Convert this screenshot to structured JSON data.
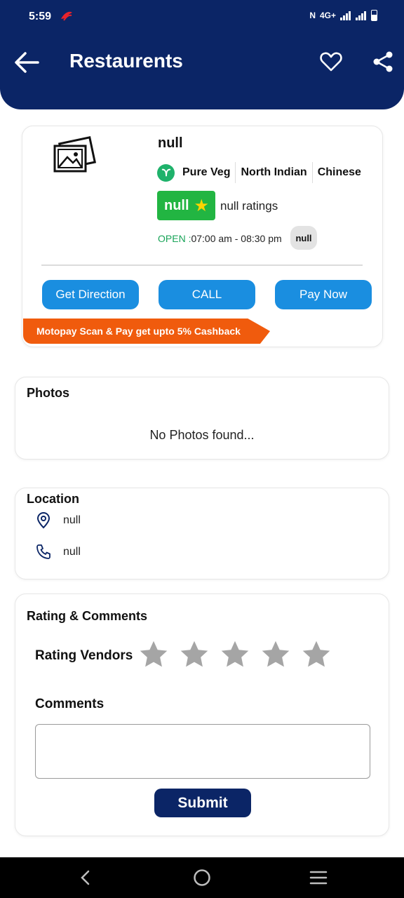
{
  "status_bar": {
    "time": "5:59",
    "network": "4G+"
  },
  "header": {
    "title": "Restaurents"
  },
  "restaurant": {
    "name": "null",
    "tags": [
      "Pure Veg",
      "North Indian",
      "Chinese"
    ],
    "rating_value": "null",
    "rating_text": "null ratings",
    "open_label": "OPEN :",
    "hours": "07:00 am - 08:30 pm",
    "chip": "null",
    "buttons": {
      "direction": "Get Direction",
      "call": "CALL",
      "pay": "Pay Now"
    },
    "promo": "Motopay Scan & Pay get upto 5% Cashback"
  },
  "photos": {
    "title": "Photos",
    "empty_text": "No Photos found..."
  },
  "location": {
    "title": "Location",
    "address": "null",
    "phone": "null"
  },
  "rating_comments": {
    "title": "Rating & Comments",
    "rating_label": "Rating Vendors",
    "rating": 0,
    "max_rating": 5,
    "comments_label": "Comments",
    "comment_value": "",
    "submit_label": "Submit"
  },
  "colors": {
    "primary": "#0b2566",
    "button_blue": "#1a8ee0",
    "green": "#22b542",
    "orange": "#f05b0d",
    "star_inactive": "#a5a5a5"
  },
  "icons": [
    "back-arrow-icon",
    "heart-icon",
    "share-icon",
    "image-placeholder-icon",
    "veg-leaf-icon",
    "star-icon",
    "location-pin-icon",
    "phone-icon",
    "nav-back-icon",
    "nav-home-icon",
    "nav-menu-icon"
  ]
}
